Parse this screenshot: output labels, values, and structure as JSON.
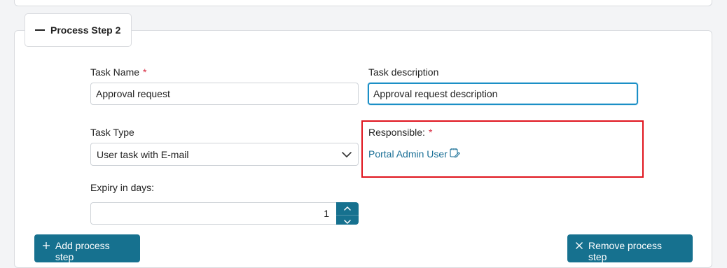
{
  "process_step": {
    "title": "Process Step 2"
  },
  "fields": {
    "task_name": {
      "label": "Task Name",
      "required_mark": "*",
      "value": "Approval request"
    },
    "task_description": {
      "label": "Task description",
      "value": "Approval request description"
    },
    "task_type": {
      "label": "Task Type",
      "value": "User task with E-mail"
    },
    "responsible": {
      "label": "Responsible:",
      "required_mark": "*",
      "value": "Portal Admin User"
    },
    "expiry": {
      "label": "Expiry in days:",
      "value": "1"
    }
  },
  "actions": {
    "add_label": "Add process step",
    "remove_label": "Remove process step"
  },
  "colors": {
    "primary": "#16718f",
    "link": "#1a6f96",
    "required": "#d92f45",
    "highlight": "#e0141e",
    "focus": "#1b8fc6"
  },
  "icons": {
    "collapse": "minus-icon",
    "select": "chevron-down-icon",
    "responsible_edit": "edit-icon",
    "stepper_up": "chevron-up-icon",
    "stepper_down": "chevron-down-icon",
    "add": "plus-icon",
    "remove": "close-icon"
  }
}
